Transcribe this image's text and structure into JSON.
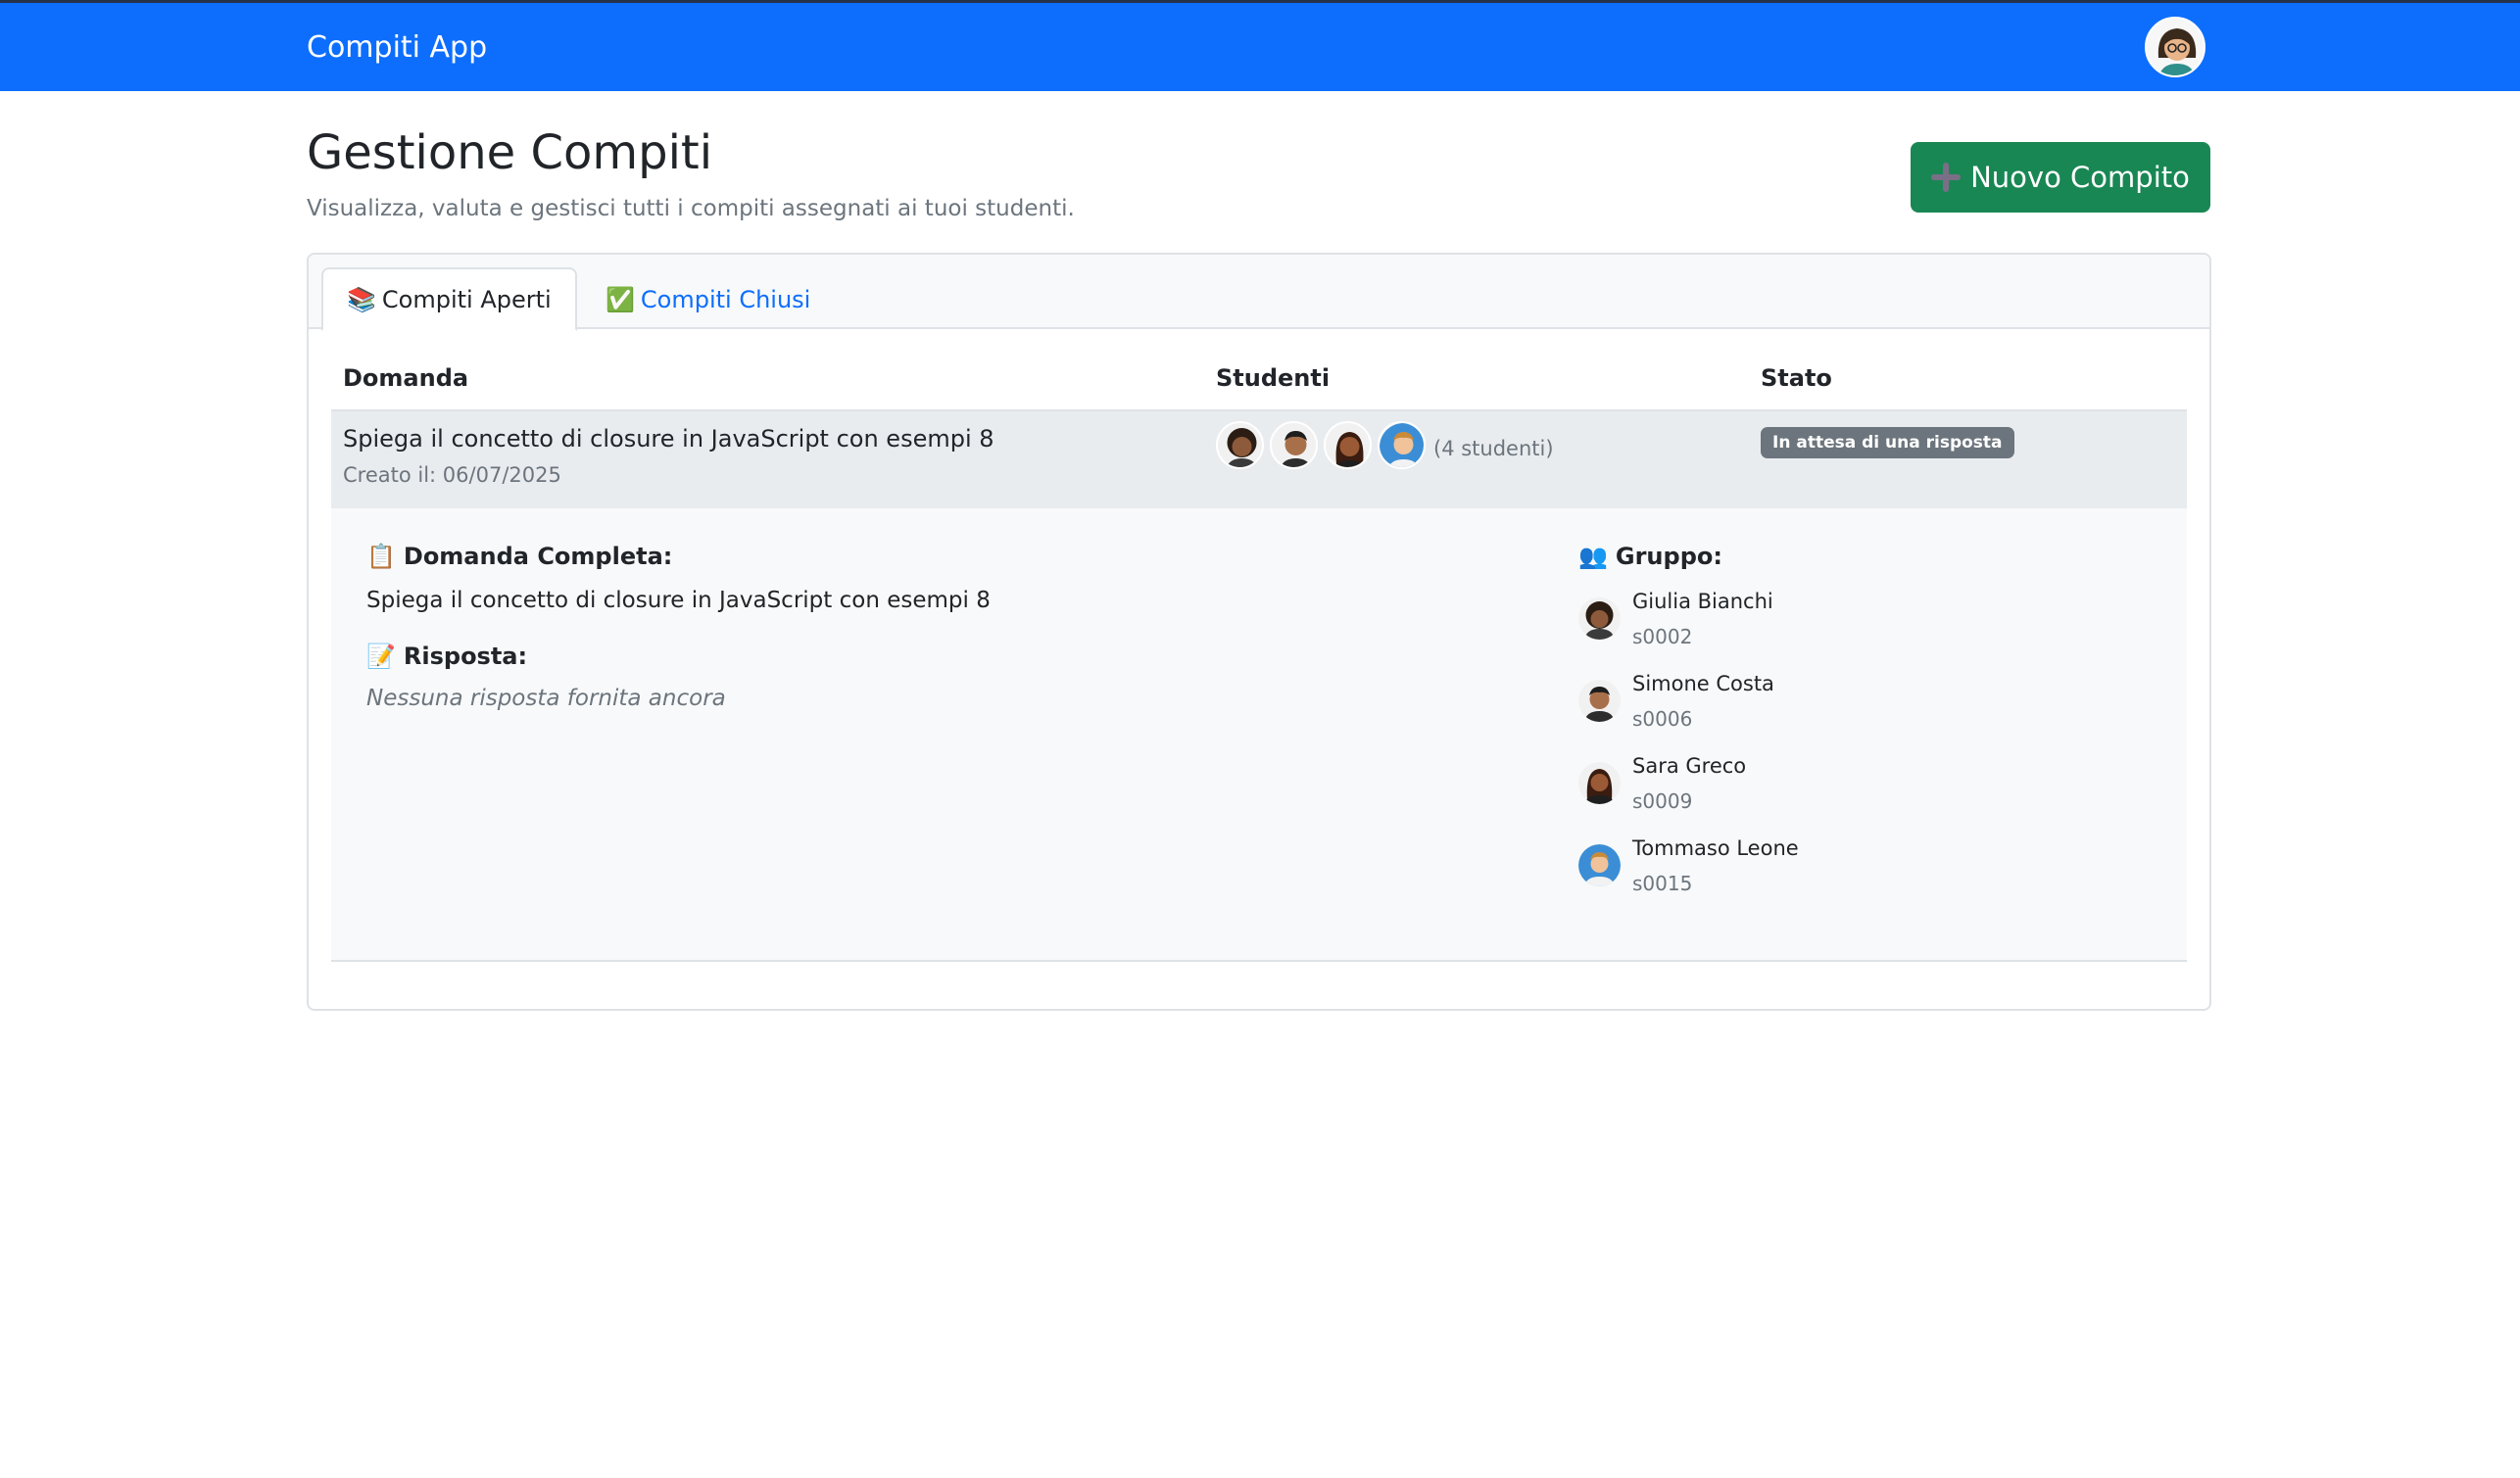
{
  "navbar": {
    "brand": "Compiti App",
    "avatar_icon": "teacher-avatar-icon"
  },
  "header": {
    "title": "Gestione Compiti",
    "subtitle": "Visualizza, valuta e gestisci tutti i compiti assegnati ai tuoi studenti.",
    "new_button": "Nuovo Compito"
  },
  "tabs": [
    {
      "icon": "📚",
      "label": "Compiti Aperti",
      "active": true
    },
    {
      "icon": "✅",
      "label": "Compiti Chiusi",
      "active": false
    }
  ],
  "table": {
    "headers": [
      "Domanda",
      "Studenti",
      "Stato"
    ],
    "row": {
      "question": "Spiega il concetto di closure in JavaScript con esempi 8",
      "created": "Creato il: 06/07/2025",
      "student_count": "(4 studenti)",
      "status": "In attesa di una risposta"
    }
  },
  "detail": {
    "full_question_icon": "📋",
    "full_question_label": "Domanda Completa:",
    "full_question": "Spiega il concetto di closure in JavaScript con esempi 8",
    "answer_icon": "📝",
    "answer_label": "Risposta:",
    "answer": "Nessuna risposta fornita ancora",
    "group_icon": "👥",
    "group_label": "Gruppo:",
    "members": [
      {
        "name": "Giulia Bianchi",
        "id": "s0002"
      },
      {
        "name": "Simone Costa",
        "id": "s0006"
      },
      {
        "name": "Sara Greco",
        "id": "s0009"
      },
      {
        "name": "Tommaso Leone",
        "id": "s0015"
      }
    ]
  },
  "colors": {
    "primary": "#0d6efd",
    "success": "#198754",
    "muted": "#6c757d",
    "row_bg": "#e9ecef",
    "detail_bg": "#f8f9fa"
  }
}
